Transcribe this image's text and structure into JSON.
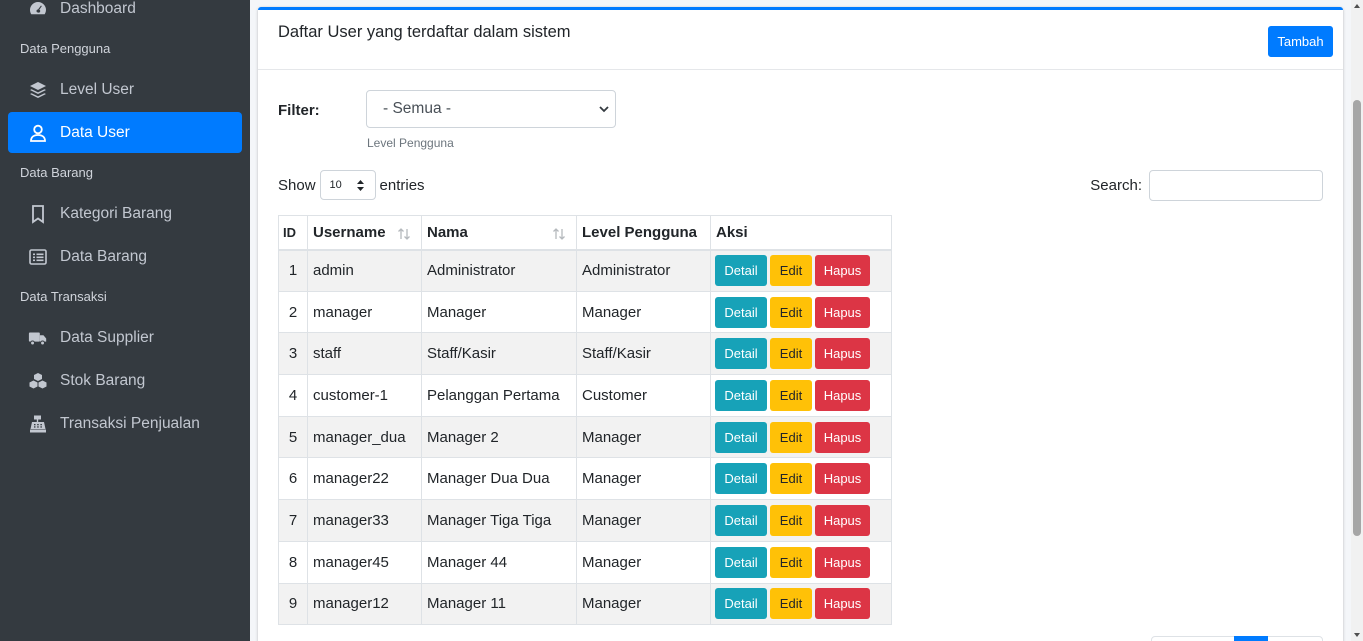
{
  "sidebar": {
    "dashboard": "Dashboard",
    "sections": [
      {
        "header": "Data Pengguna",
        "items": [
          {
            "label": "Level User",
            "icon": "layers-icon"
          },
          {
            "label": "Data User",
            "icon": "user-icon",
            "active": true
          }
        ]
      },
      {
        "header": "Data Barang",
        "items": [
          {
            "label": "Kategori Barang",
            "icon": "bookmark-icon"
          },
          {
            "label": "Data Barang",
            "icon": "list-icon"
          }
        ]
      },
      {
        "header": "Data Transaksi",
        "items": [
          {
            "label": "Data Supplier",
            "icon": "truck-icon"
          },
          {
            "label": "Stok Barang",
            "icon": "cubes-icon"
          },
          {
            "label": "Transaksi Penjualan",
            "icon": "cash-register-icon"
          }
        ]
      }
    ]
  },
  "card": {
    "title": "Daftar User yang terdaftar dalam sistem",
    "add_button": "Tambah"
  },
  "filter": {
    "label": "Filter:",
    "selected": "- Semua -",
    "hint": "Level Pengguna"
  },
  "table_controls": {
    "show_label": "Show",
    "entries_value": "10",
    "entries_label": "entries",
    "search_label": "Search:"
  },
  "table": {
    "columns": [
      "ID",
      "Username",
      "Nama",
      "Level Pengguna",
      "Aksi"
    ],
    "rows": [
      {
        "no": "1",
        "username": "admin",
        "nama": "Administrator",
        "level": "Administrator"
      },
      {
        "no": "2",
        "username": "manager",
        "nama": "Manager",
        "level": "Manager"
      },
      {
        "no": "3",
        "username": "staff",
        "nama": "Staff/Kasir",
        "level": "Staff/Kasir"
      },
      {
        "no": "4",
        "username": "customer-1",
        "nama": "Pelanggan Pertama",
        "level": "Customer"
      },
      {
        "no": "5",
        "username": "manager_dua",
        "nama": "Manager 2",
        "level": "Manager"
      },
      {
        "no": "6",
        "username": "manager22",
        "nama": "Manager Dua Dua",
        "level": "Manager"
      },
      {
        "no": "7",
        "username": "manager33",
        "nama": "Manager Tiga Tiga",
        "level": "Manager"
      },
      {
        "no": "8",
        "username": "manager45",
        "nama": "Manager 44",
        "level": "Manager"
      },
      {
        "no": "9",
        "username": "manager12",
        "nama": "Manager 11",
        "level": "Manager"
      }
    ],
    "actions": {
      "detail": "Detail",
      "edit": "Edit",
      "delete": "Hapus"
    }
  },
  "colors": {
    "sidebar_bg": "#343a40",
    "primary": "#007bff",
    "info": "#17a2b8",
    "warning": "#ffc107",
    "danger": "#dc3545"
  }
}
